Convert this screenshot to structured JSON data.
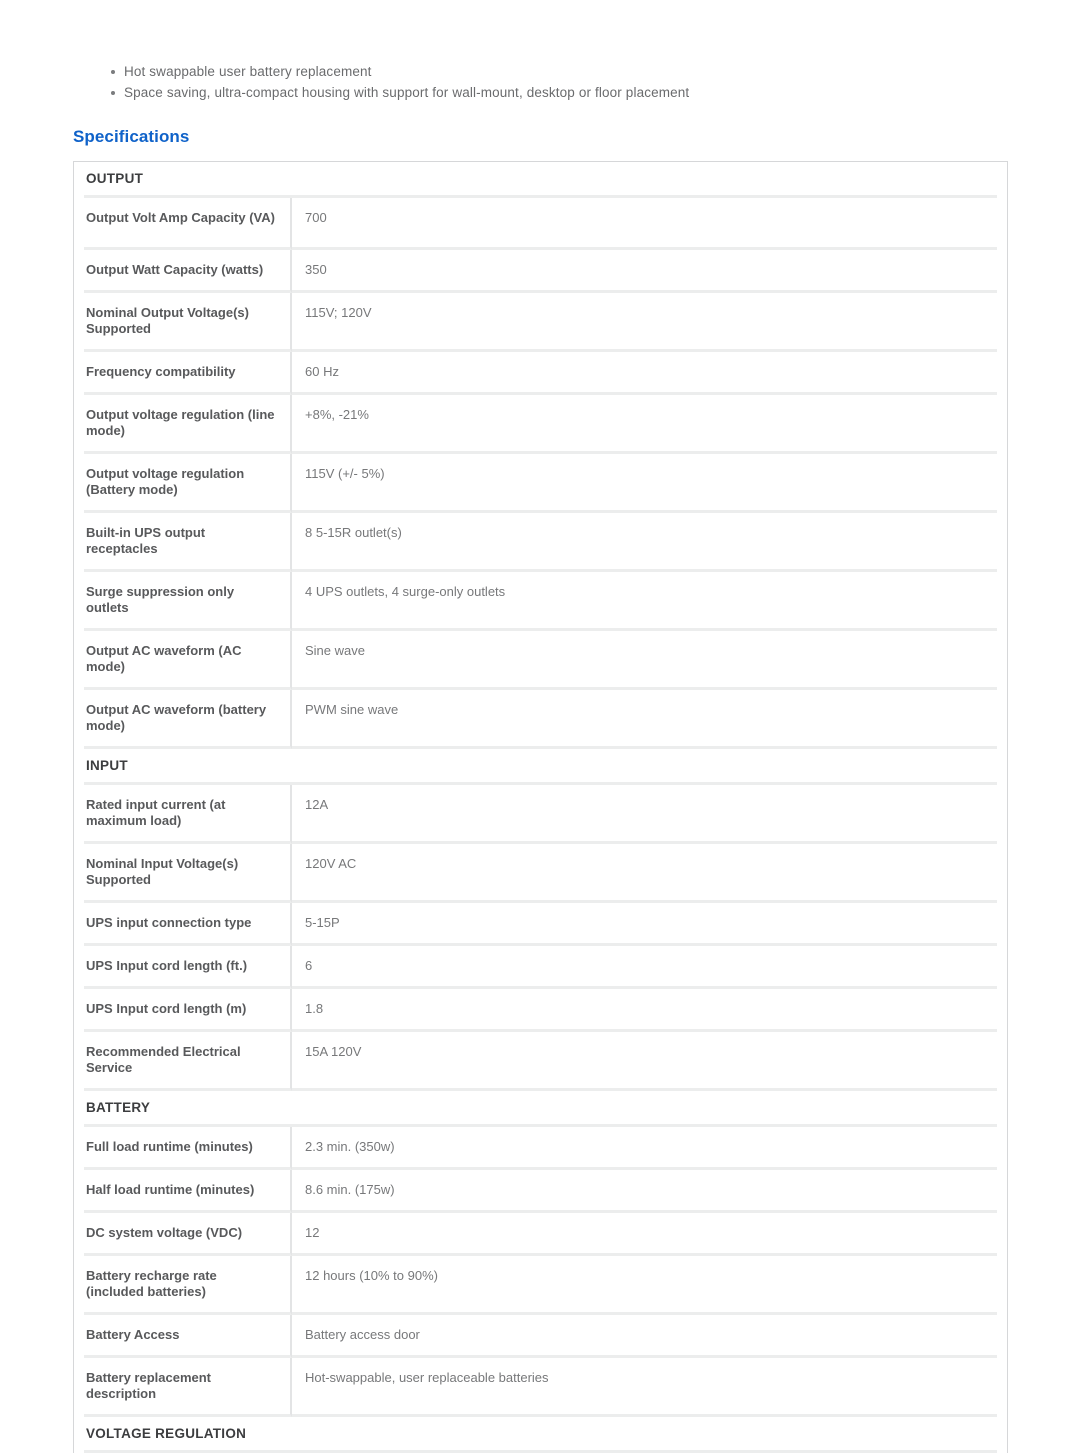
{
  "features": [
    "Hot swappable user battery replacement",
    "Space saving, ultra-compact housing with support for wall-mount, desktop or floor placement"
  ],
  "heading": "Specifications",
  "colors": {
    "heading": "#0f62c9",
    "label_text": "#58595b",
    "value_text": "#77787a",
    "rule": "#eceded",
    "border": "#d6d7d9"
  },
  "sections": [
    {
      "title": "OUTPUT",
      "rows": [
        {
          "label": "Output Volt Amp Capacity (VA)",
          "value": "700",
          "lines": 2
        },
        {
          "label": "Output Watt Capacity (watts)",
          "value": "350",
          "lines": 1
        },
        {
          "label": "Nominal Output Voltage(s) Supported",
          "value": "115V; 120V",
          "lines": 2
        },
        {
          "label": "Frequency compatibility",
          "value": "60 Hz",
          "lines": 1
        },
        {
          "label": "Output voltage regulation (line mode)",
          "value": "+8%, -21%",
          "lines": 2
        },
        {
          "label": "Output voltage regulation (Battery mode)",
          "value": "115V (+/- 5%)",
          "lines": 2
        },
        {
          "label": "Built-in UPS output receptacles",
          "value": "8 5-15R outlet(s)",
          "lines": 2
        },
        {
          "label": "Surge suppression only outlets",
          "value": "4 UPS outlets, 4 surge-only outlets",
          "lines": 2
        },
        {
          "label": "Output AC waveform (AC mode)",
          "value": "Sine wave",
          "lines": 2
        },
        {
          "label": "Output AC waveform (battery mode)",
          "value": "PWM sine wave",
          "lines": 2
        }
      ]
    },
    {
      "title": "INPUT",
      "rows": [
        {
          "label": "Rated input current (at maximum load)",
          "value": "12A",
          "lines": 2
        },
        {
          "label": "Nominal Input Voltage(s) Supported",
          "value": "120V AC",
          "lines": 2
        },
        {
          "label": "UPS input connection type",
          "value": "5-15P",
          "lines": 1
        },
        {
          "label": "UPS Input cord length (ft.)",
          "value": "6",
          "lines": 1
        },
        {
          "label": "UPS Input cord length (m)",
          "value": "1.8",
          "lines": 1
        },
        {
          "label": "Recommended Electrical Service",
          "value": "15A 120V",
          "lines": 2
        }
      ]
    },
    {
      "title": "BATTERY",
      "rows": [
        {
          "label": "Full load runtime (minutes)",
          "value": "2.3 min. (350w)",
          "lines": 1
        },
        {
          "label": "Half load runtime (minutes)",
          "value": "8.6 min. (175w)",
          "lines": 1
        },
        {
          "label": "DC system voltage (VDC)",
          "value": "12",
          "lines": 1
        },
        {
          "label": "Battery recharge rate (included batteries)",
          "value": "12 hours (10% to 90%)",
          "lines": 2
        },
        {
          "label": "Battery Access",
          "value": "Battery access door",
          "lines": 1
        },
        {
          "label": "Battery replacement description",
          "value": "Hot-swappable, user replaceable batteries",
          "lines": 2
        }
      ]
    },
    {
      "title": "VOLTAGE REGULATION",
      "rows": []
    }
  ]
}
